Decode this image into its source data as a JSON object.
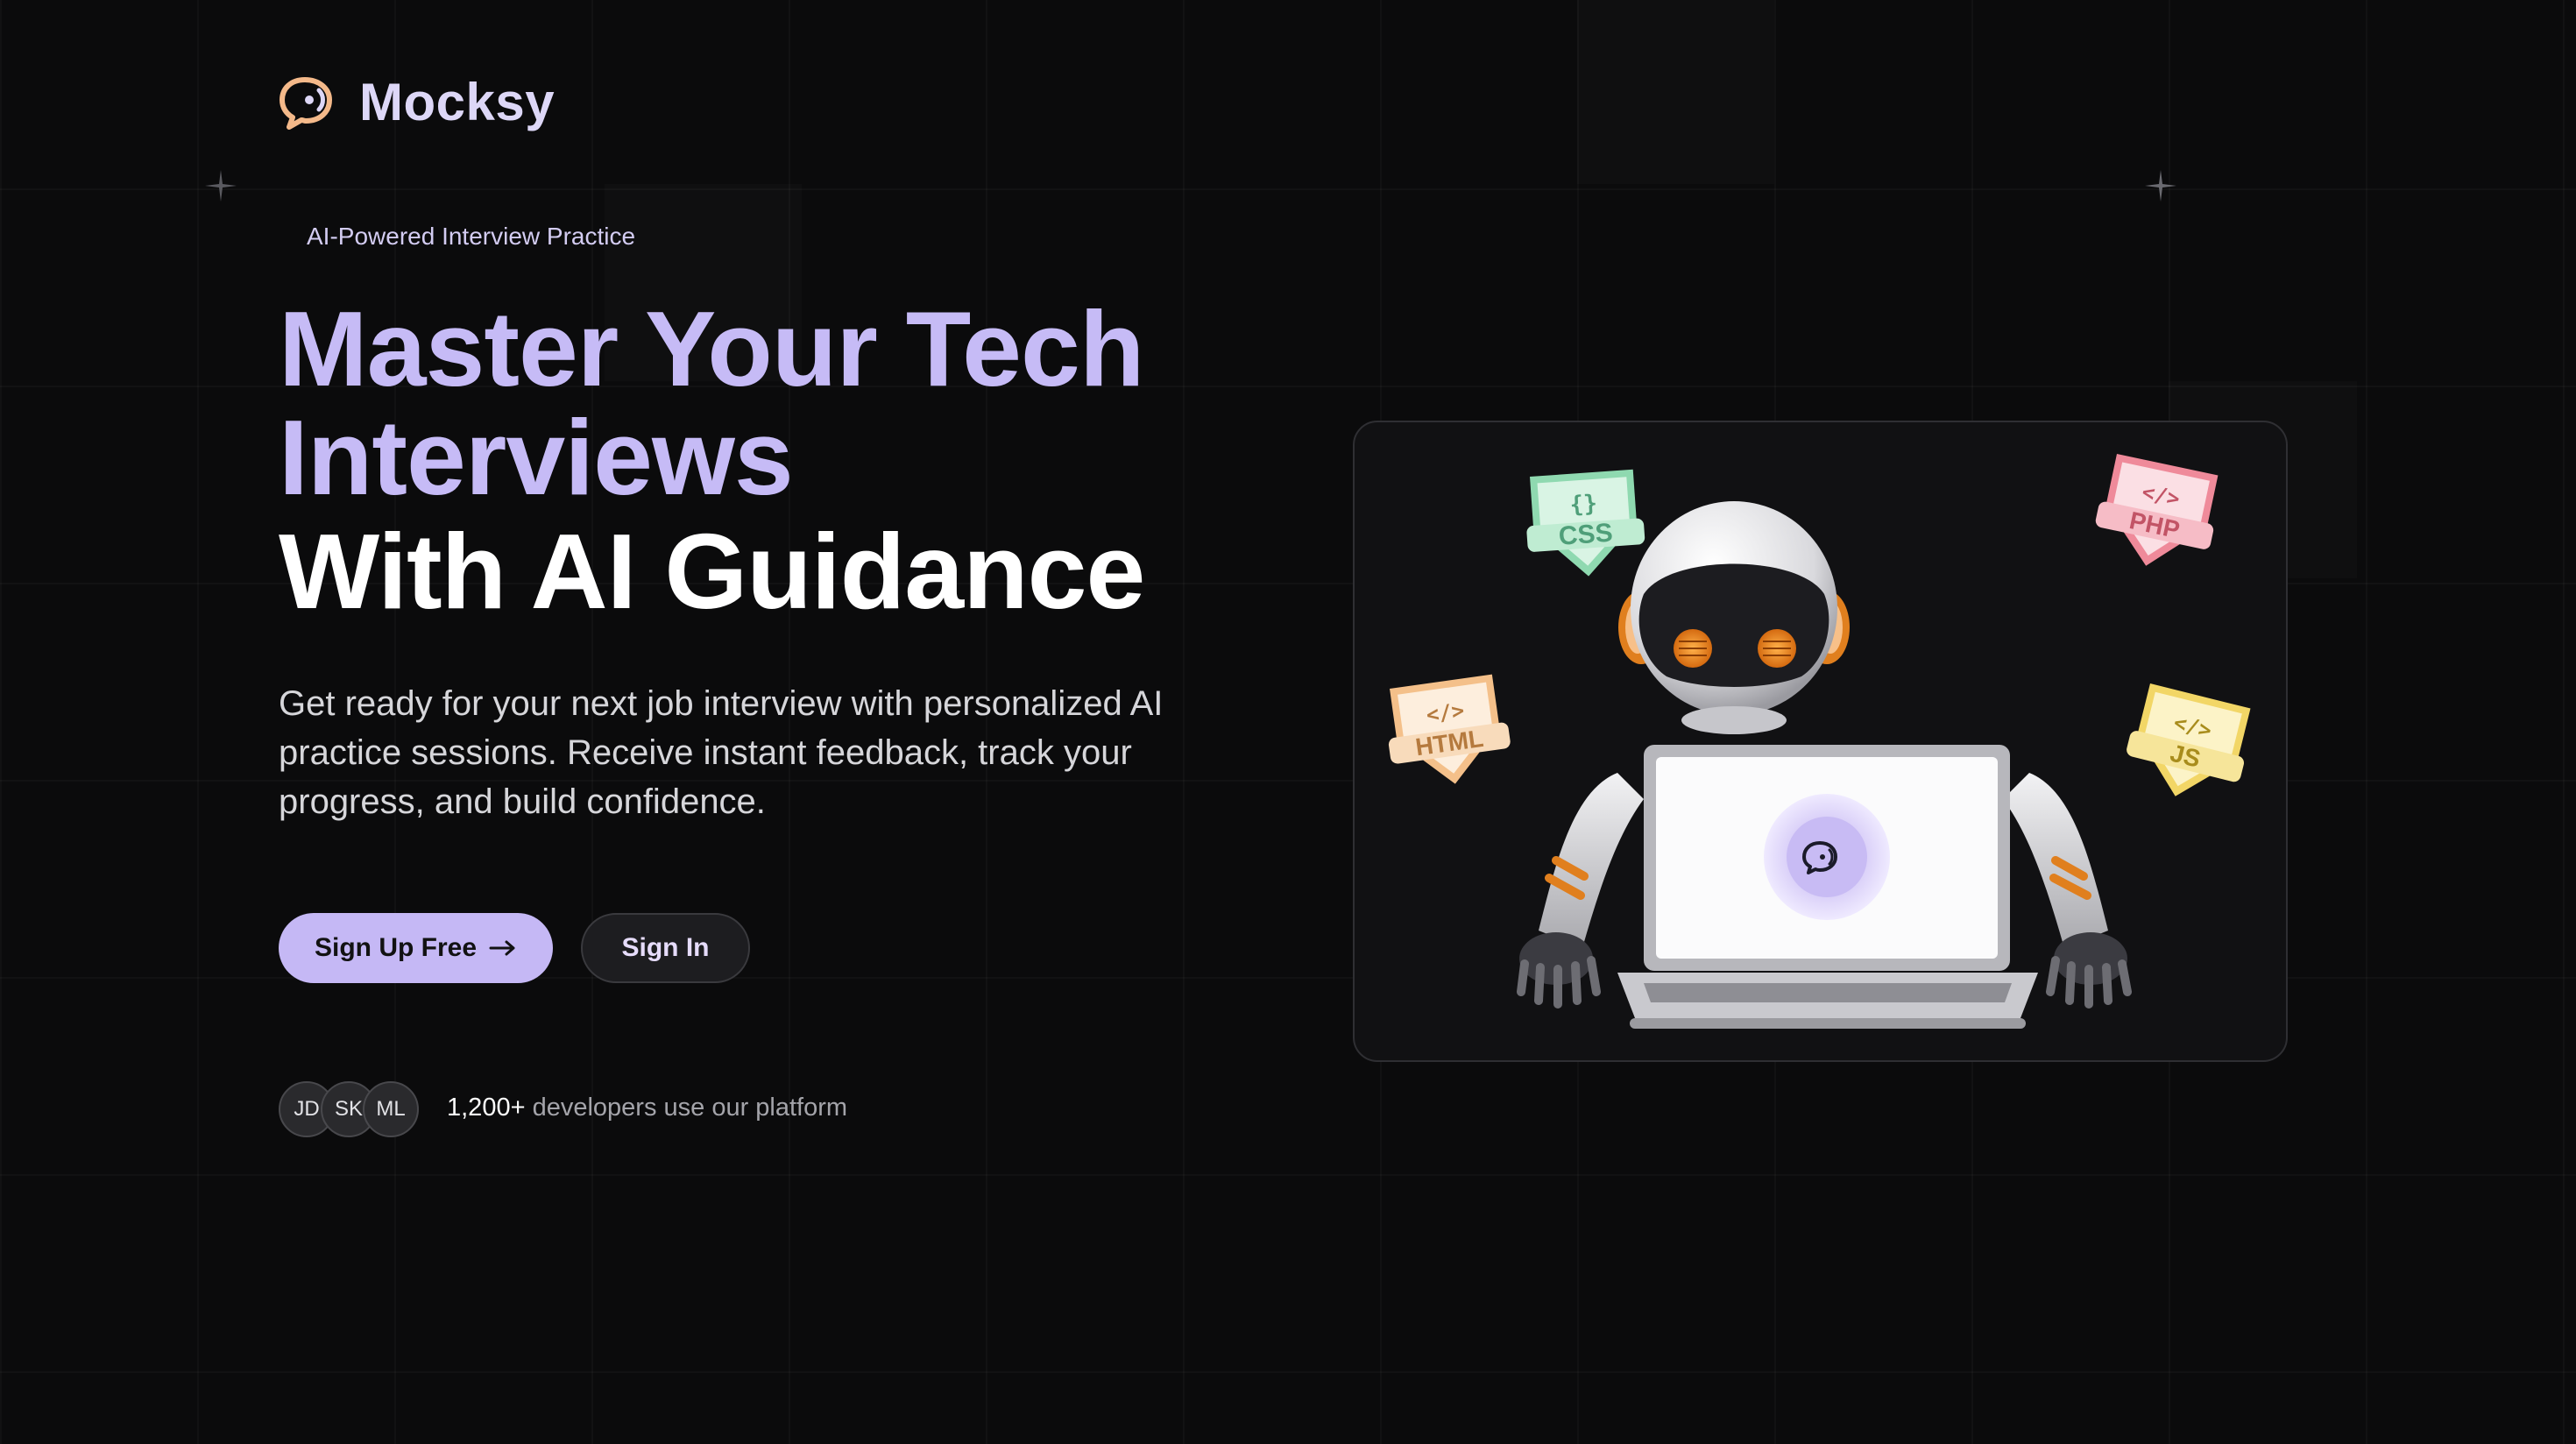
{
  "brand": {
    "name": "Mocksy",
    "accent_color": "#c5b8f5",
    "icon": "chat-bubble-icon"
  },
  "hero": {
    "tag": "AI-Powered Interview Practice",
    "title_line1": "Master Your Tech",
    "title_line2": "Interviews",
    "title_line3": "With AI Guidance",
    "description": "Get ready for your next job interview with personalized AI practice sessions. Receive instant feedback, track your progress, and build confidence."
  },
  "actions": {
    "signup_label": "Sign Up Free",
    "signup_icon": "arrow-right-icon",
    "signin_label": "Sign In"
  },
  "social_proof": {
    "avatars": [
      "JD",
      "SK",
      "ML"
    ],
    "count": "1,200+",
    "text": " developers use our platform"
  },
  "illustration": {
    "badges": [
      "CSS",
      "PHP",
      "HTML",
      "JS"
    ],
    "badge_colors": {
      "CSS": "#8fd9b0",
      "PHP": "#ef8a9a",
      "HTML": "#f4c08a",
      "JS": "#f2d666"
    }
  }
}
